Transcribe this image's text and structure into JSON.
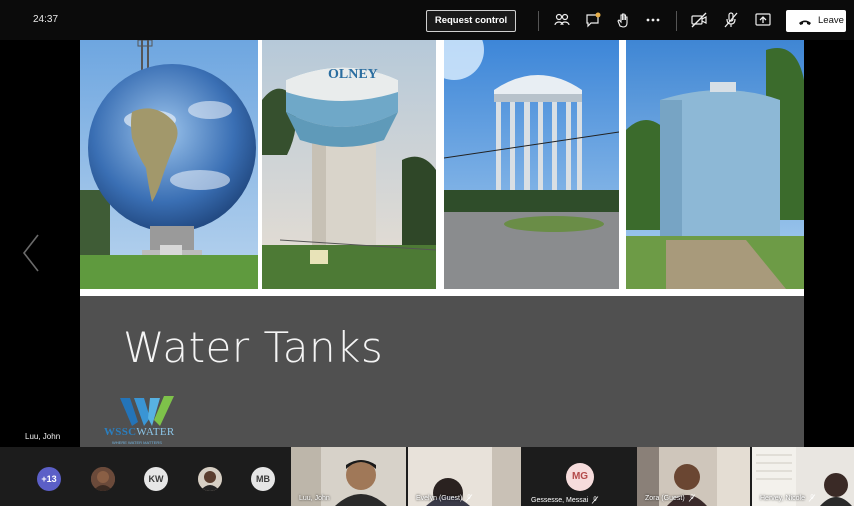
{
  "topbar": {
    "timer": "24:37",
    "request_control_label": "Request control",
    "leave_label": "Leave",
    "icons": [
      "participants-icon",
      "chat-icon",
      "raise-hand-icon",
      "more-actions-icon",
      "camera-off-icon",
      "mic-off-icon",
      "share-icon",
      "leave-phone-icon"
    ]
  },
  "stage": {
    "presenter_name": "Luu, John",
    "slide": {
      "title": "Water Tanks",
      "photos": [
        "globe-water-tower-photo",
        "olney-water-tower-photo",
        "pedestal-water-tower-photo",
        "standpipe-water-tank-photo"
      ],
      "olney_sign": "OLNEY",
      "logo_text": "WSSC",
      "logo_partial": "WATER",
      "logo_tagline": "WHERE WATER MATTERS"
    }
  },
  "participants": {
    "more_count": "+13",
    "bubbles": [
      {
        "initials": "",
        "kind": "photo"
      },
      {
        "initials": "KW",
        "kind": "initials"
      },
      {
        "initials": "",
        "kind": "photo"
      },
      {
        "initials": "MB",
        "kind": "initials"
      }
    ],
    "tiles": [
      {
        "name": "Luu, John"
      },
      {
        "name": "Evelyn (Guest)"
      },
      {
        "name": "Gessesse, Messai",
        "initials": "MG"
      },
      {
        "name": "Zora (Guest)"
      },
      {
        "name": "Hervey, Nicole"
      }
    ]
  },
  "colors": {
    "topbar_bg": "#0b0b0b",
    "slide_bg": "#505050",
    "more_bubble": "#5b5fc7",
    "leave_button_bg": "#ffffff"
  }
}
